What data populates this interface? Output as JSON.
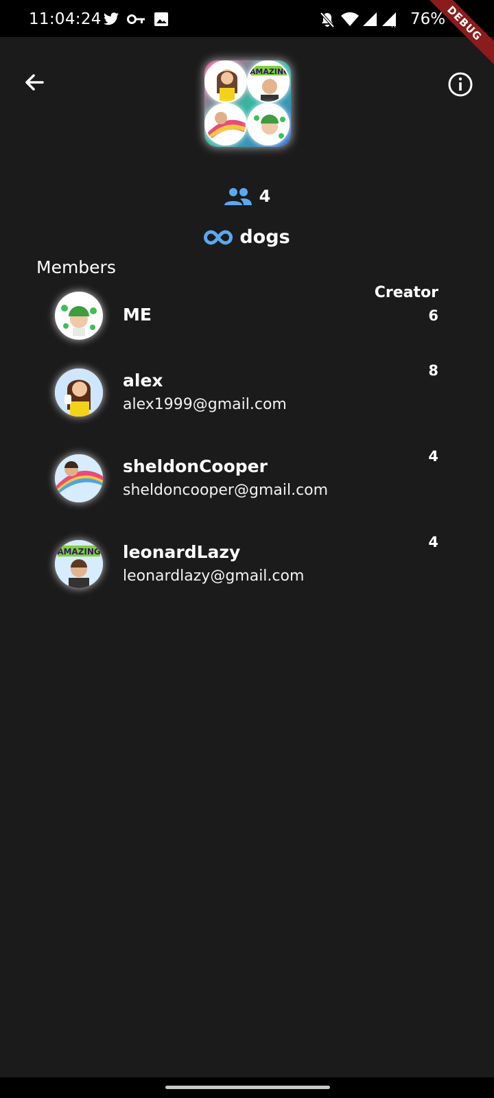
{
  "status_bar": {
    "time": "11:04:24",
    "battery": "76%",
    "icons": [
      "twitter-icon",
      "key-icon",
      "image-icon",
      "mute-bell-icon",
      "wifi-icon",
      "signal-icon",
      "signal-roaming-icon",
      "battery-icon"
    ]
  },
  "debug_banner": "DEBUG",
  "header": {
    "back_icon": "arrow-back-icon",
    "info_icon": "info-icon"
  },
  "group": {
    "member_count": "4",
    "name": "dogs"
  },
  "members_heading": "Members",
  "members": [
    {
      "name": "ME",
      "email": "",
      "score": "6",
      "role": "Creator"
    },
    {
      "name": "alex",
      "email": "alex1999@gmail.com",
      "score": "8",
      "role": ""
    },
    {
      "name": "sheldonCooper",
      "email": "sheldoncooper@gmail.com",
      "score": "4",
      "role": ""
    },
    {
      "name": "leonardLazy",
      "email": "leonardlazy@gmail.com",
      "score": "4",
      "role": ""
    }
  ],
  "colors": {
    "background": "#1b1b1b",
    "accent": "#5aa9f0",
    "debug": "#8b1c1c"
  }
}
